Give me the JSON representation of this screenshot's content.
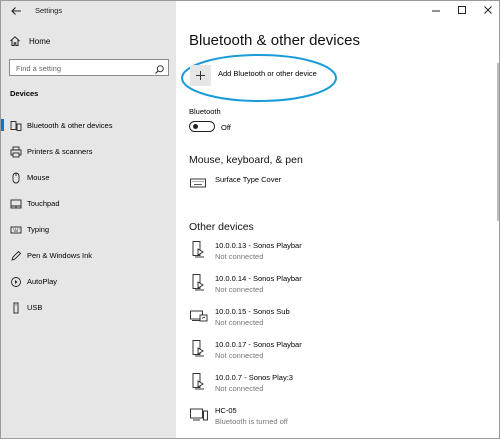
{
  "window": {
    "title": "Settings"
  },
  "sidebar": {
    "home_label": "Home",
    "search_placeholder": "Find a setting",
    "section_title": "Devices",
    "items": [
      {
        "label": "Bluetooth & other devices",
        "icon": "bluetooth-devices-icon",
        "selected": true
      },
      {
        "label": "Printers & scanners",
        "icon": "printer-icon"
      },
      {
        "label": "Mouse",
        "icon": "mouse-icon"
      },
      {
        "label": "Touchpad",
        "icon": "touchpad-icon"
      },
      {
        "label": "Typing",
        "icon": "keyboard-icon"
      },
      {
        "label": "Pen & Windows Ink",
        "icon": "pen-icon"
      },
      {
        "label": "AutoPlay",
        "icon": "autoplay-icon"
      },
      {
        "label": "USB",
        "icon": "usb-icon"
      }
    ]
  },
  "main": {
    "page_title": "Bluetooth & other devices",
    "add_button_label": "Add Bluetooth or other device",
    "bluetooth": {
      "label": "Bluetooth",
      "state": "Off"
    },
    "groups": [
      {
        "title": "Mouse, keyboard, & pen",
        "devices": [
          {
            "name": "Surface Type Cover",
            "status": "",
            "icon": "keyboard-icon"
          }
        ]
      },
      {
        "title": "Other devices",
        "devices": [
          {
            "name": "10.0.0.13 - Sonos Playbar",
            "status": "Not connected",
            "icon": "media-device-icon"
          },
          {
            "name": "10.0.0.14 - Sonos Playbar",
            "status": "Not connected",
            "icon": "media-device-icon"
          },
          {
            "name": "10.0.0.15 - Sonos Sub",
            "status": "Not connected",
            "icon": "network-device-icon"
          },
          {
            "name": "10.0.0.17 - Sonos Playbar",
            "status": "Not connected",
            "icon": "media-device-icon"
          },
          {
            "name": "10.0.0.7 - Sonos Play:3",
            "status": "Not connected",
            "icon": "media-device-icon"
          },
          {
            "name": "HC-05",
            "status": "Bluetooth is turned off",
            "icon": "generic-device-icon"
          }
        ]
      }
    ]
  },
  "colors": {
    "accent": "#0078d7",
    "highlight_ellipse": "#1a9cd8",
    "sidebar_bg": "#e6e6e6"
  }
}
